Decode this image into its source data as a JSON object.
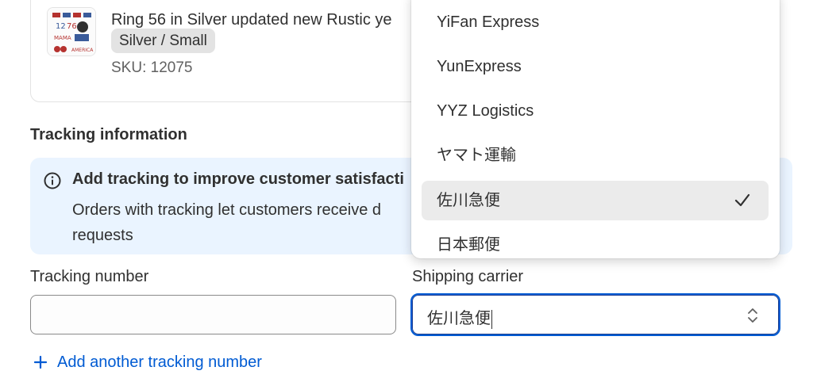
{
  "product": {
    "title": "Ring 56 in Silver updated new Rustic ye",
    "variant": "Silver / Small",
    "sku": "SKU: 12075"
  },
  "tracking": {
    "heading": "Tracking information",
    "banner_title": "Add tracking to improve customer satisfacti",
    "banner_body": "Orders with tracking let customers receive d requests",
    "banner_body_line1": "Orders with tracking let customers receive d",
    "banner_body_line2": "requests",
    "tracking_number_label": "Tracking number",
    "tracking_number_value": "",
    "shipping_carrier_label": "Shipping carrier",
    "shipping_carrier_value": "佐川急便",
    "add_another_label": "Add another tracking number"
  },
  "carrier_dropdown": {
    "options": [
      {
        "label": "YiFan Express",
        "selected": false
      },
      {
        "label": "YunExpress",
        "selected": false
      },
      {
        "label": "YYZ Logistics",
        "selected": false
      },
      {
        "label": "ヤマト運輸",
        "selected": false
      },
      {
        "label": "佐川急便",
        "selected": true
      },
      {
        "label": "日本郵便",
        "selected": false
      }
    ]
  },
  "colors": {
    "accent": "#005bd3",
    "banner_bg": "#eaf4ff",
    "selected_option_bg": "#ebebeb"
  },
  "icons": {
    "info": "info-icon",
    "check": "check-icon",
    "plus": "plus-icon",
    "select": "select-chevrons-icon"
  }
}
